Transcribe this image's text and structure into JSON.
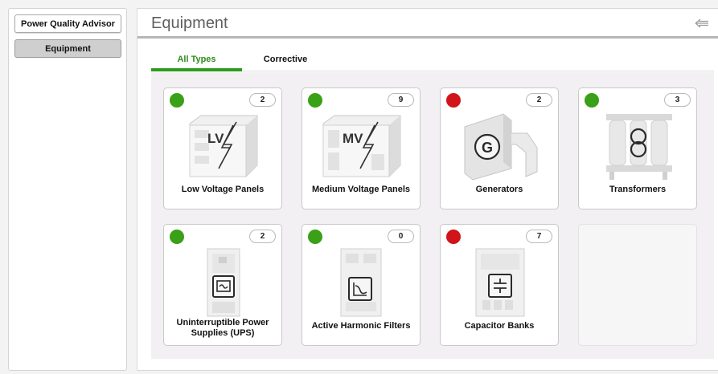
{
  "sidebar": {
    "items": [
      {
        "label": "Power Quality Advisor"
      },
      {
        "label": "Equipment"
      }
    ]
  },
  "header": {
    "title": "Equipment",
    "back_icon": "back-arrow-icon"
  },
  "tabs": [
    {
      "label": "All Types",
      "active": true
    },
    {
      "label": "Corrective",
      "active": false
    }
  ],
  "colors": {
    "status_ok": "#3aa017",
    "status_alarm": "#d0141a",
    "tab_active": "#2e9a1e"
  },
  "equipment": [
    {
      "label": "Low Voltage Panels",
      "count": "2",
      "status": "ok",
      "icon": "lv-panel-icon",
      "icon_text": "LV"
    },
    {
      "label": "Medium Voltage Panels",
      "count": "9",
      "status": "ok",
      "icon": "mv-panel-icon",
      "icon_text": "MV"
    },
    {
      "label": "Generators",
      "count": "2",
      "status": "alarm",
      "icon": "generator-icon",
      "icon_text": "G"
    },
    {
      "label": "Transformers",
      "count": "3",
      "status": "ok",
      "icon": "transformer-icon"
    },
    {
      "label": "Uninterruptible Power Supplies (UPS)",
      "count": "2",
      "status": "ok",
      "icon": "ups-icon"
    },
    {
      "label": "Active Harmonic Filters",
      "count": "0",
      "status": "ok",
      "icon": "harmonic-filter-icon"
    },
    {
      "label": "Capacitor Banks",
      "count": "7",
      "status": "alarm",
      "icon": "capacitor-bank-icon"
    }
  ]
}
